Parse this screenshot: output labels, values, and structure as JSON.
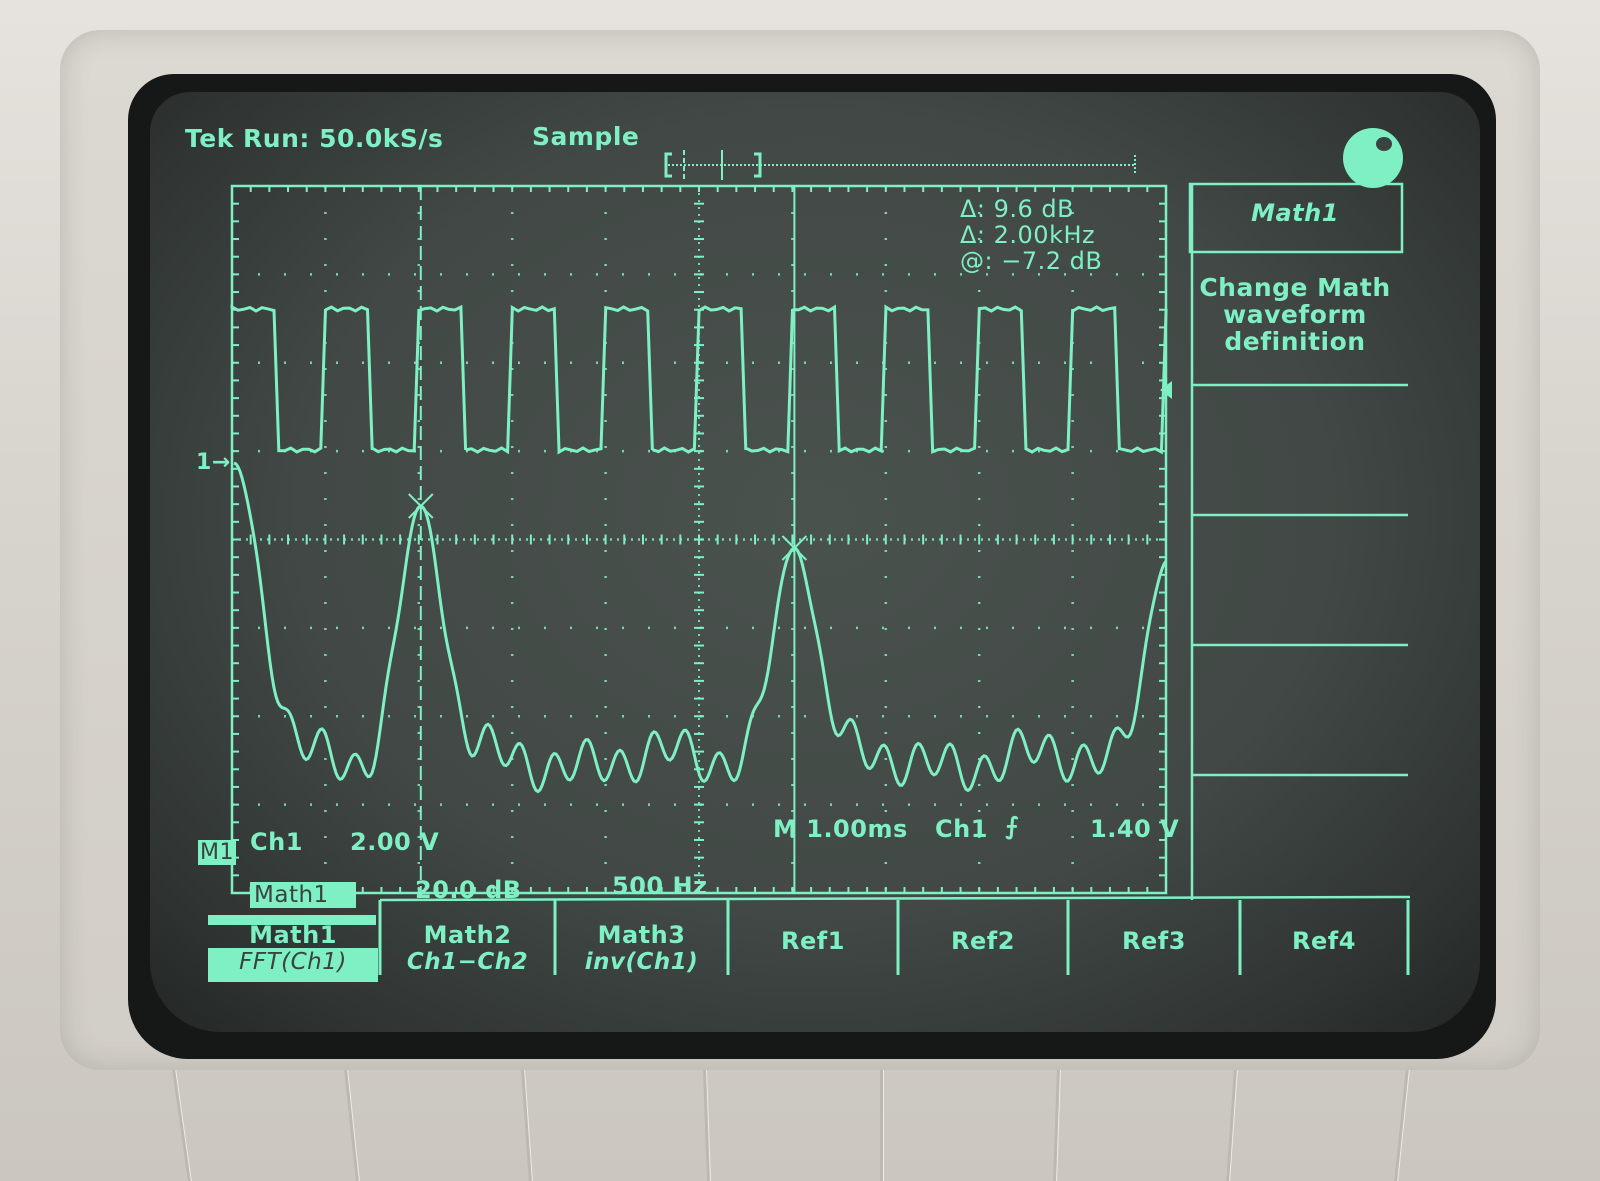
{
  "status_bar": {
    "brand": "Tek",
    "acq_state": "Run:",
    "sample_rate": "50.0kS/s",
    "acq_mode": "Sample"
  },
  "cursor_readout": {
    "delta_amplitude": "Δ: 9.6 dB",
    "delta_frequency": "Δ: 2.00kHz",
    "at_value": "@: −7.2 dB"
  },
  "side_menu": {
    "title": "Math1",
    "description_lines": [
      "Change Math",
      "waveform",
      "definition"
    ],
    "items": [
      "",
      "",
      "",
      ""
    ]
  },
  "channel_readout": {
    "marker_m1": "M1",
    "ch1_label": "Ch1",
    "ch1_scale": "2.00 V",
    "math1_label": "Math1",
    "math1_scale": "20.0 dB",
    "math1_freq": "500 Hz",
    "timebase": "M 1.00ms",
    "trigger_source": "Ch1",
    "trigger_slope": "rising",
    "trigger_slope_glyph": "⨍",
    "trigger_level": "1.40 V",
    "ground_marker": "1→"
  },
  "bottom_menu": [
    {
      "label": "Math1",
      "sub": "FFT(Ch1)",
      "selected": true
    },
    {
      "label": "Math2",
      "sub": "Ch1−Ch2",
      "selected": false
    },
    {
      "label": "Math3",
      "sub": "inv(Ch1)",
      "selected": false
    },
    {
      "label": "Ref1",
      "sub": "",
      "selected": false
    },
    {
      "label": "Ref2",
      "sub": "",
      "selected": false
    },
    {
      "label": "Ref3",
      "sub": "",
      "selected": false
    },
    {
      "label": "Ref4",
      "sub": "",
      "selected": false
    }
  ],
  "colors": {
    "phosphor": "#7ef0c3",
    "screen": "#434a47",
    "bezel": "#d6d2cc"
  },
  "waveforms": {
    "ch1": {
      "type": "square",
      "frequency_hz": 1000,
      "duty": 0.5,
      "divisions_per_period": 1
    },
    "math1": {
      "type": "fft",
      "source": "Ch1",
      "peaks_hz": [
        0,
        1000,
        3000,
        5000
      ],
      "cursor_marks_hz": [
        1000,
        3000
      ]
    }
  }
}
